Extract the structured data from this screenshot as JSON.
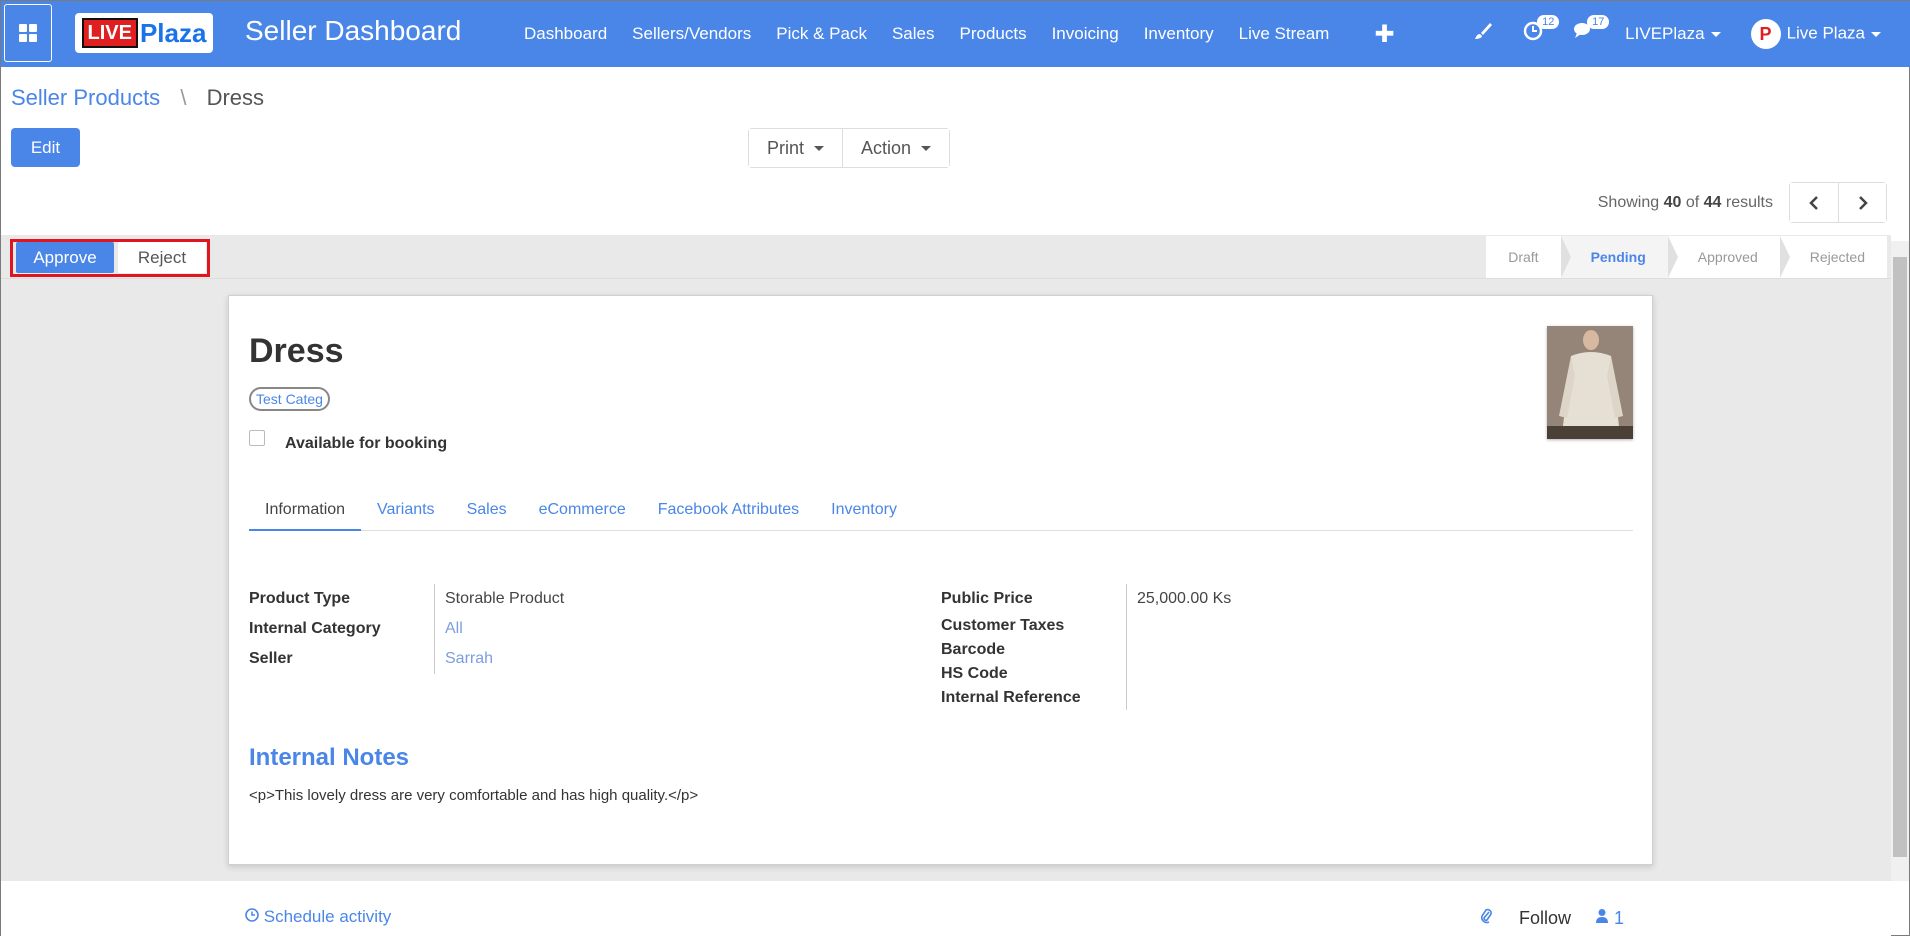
{
  "navbar": {
    "logo_live": "LIVE",
    "logo_plaza": "Plaza",
    "app_title": "Seller Dashboard",
    "menu": [
      "Dashboard",
      "Sellers/Vendors",
      "Pick & Pack",
      "Sales",
      "Products",
      "Invoicing",
      "Inventory",
      "Live Stream"
    ],
    "plus": "✚",
    "activity_count": "12",
    "messages_count": "17",
    "company": "LIVEPlaza",
    "user": "Live Plaza",
    "avatar_letter": "P"
  },
  "breadcrumb": {
    "parent": "Seller Products",
    "separator": "\\",
    "current": "Dress"
  },
  "toolbar": {
    "edit": "Edit",
    "print": "Print",
    "action": "Action"
  },
  "pager": {
    "prefix": "Showing",
    "current": "40",
    "of": "of",
    "total": "44",
    "suffix": "results"
  },
  "status_buttons": {
    "approve": "Approve",
    "reject": "Reject"
  },
  "stages": [
    "Draft",
    "Pending",
    "Approved",
    "Rejected"
  ],
  "active_stage": "Pending",
  "product": {
    "name": "Dress",
    "tag": "Test Categ",
    "booking_label": "Available for booking",
    "booking_checked": false
  },
  "tabs": [
    "Information",
    "Variants",
    "Sales",
    "eCommerce",
    "Facebook Attributes",
    "Inventory"
  ],
  "info_left": [
    {
      "label": "Product Type",
      "value": "Storable Product",
      "link": false
    },
    {
      "label": "Internal Category",
      "value": "All",
      "link": true
    },
    {
      "label": "Seller",
      "value": "Sarrah",
      "link": true
    }
  ],
  "info_right": [
    {
      "label": "Public Price",
      "value": "25,000.00 Ks"
    },
    {
      "label": "Customer Taxes",
      "value": ""
    },
    {
      "label": "Barcode",
      "value": ""
    },
    {
      "label": "HS Code",
      "value": ""
    },
    {
      "label": "Internal Reference",
      "value": ""
    }
  ],
  "notes": {
    "title": "Internal Notes",
    "body": "<p>This lovely dress are very comfortable and has high quality.</p>"
  },
  "chatter": {
    "schedule": "Schedule activity",
    "follow": "Follow",
    "followers": "1"
  },
  "colors": {
    "primary": "#4a86e8",
    "highlight": "#e0151f"
  }
}
